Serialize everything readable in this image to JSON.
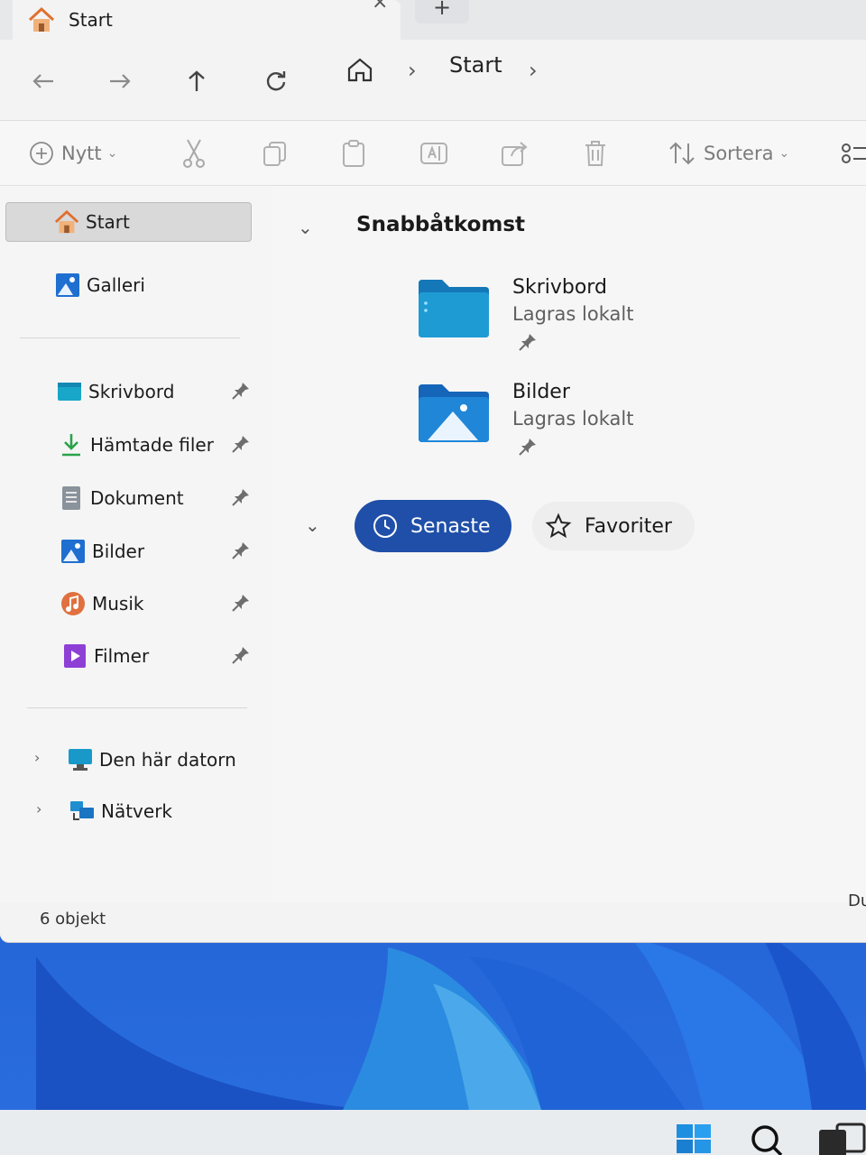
{
  "window": {
    "tab_title": "Start",
    "tab_close": "×",
    "new_tab": "+"
  },
  "navigation": {
    "breadcrumb": [
      "Start"
    ],
    "chevron": "›"
  },
  "toolbar": {
    "new_label": "Nytt",
    "sort_label": "Sortera",
    "dropdown_glyph": "⌄"
  },
  "sidebar": {
    "top_items": [
      {
        "label": "Start",
        "icon": "home-icon",
        "selected": true
      },
      {
        "label": "Galleri",
        "icon": "gallery-icon"
      }
    ],
    "pinned_items": [
      {
        "label": "Skrivbord",
        "icon": "desktop-icon"
      },
      {
        "label": "Hämtade filer",
        "icon": "downloads-icon"
      },
      {
        "label": "Dokument",
        "icon": "documents-icon"
      },
      {
        "label": "Bilder",
        "icon": "pictures-icon"
      },
      {
        "label": "Musik",
        "icon": "music-icon"
      },
      {
        "label": "Filmer",
        "icon": "videos-icon"
      }
    ],
    "locations": [
      {
        "label": "Den här datorn",
        "icon": "this-pc-icon"
      },
      {
        "label": "Nätverk",
        "icon": "network-icon"
      }
    ],
    "expander_glyph": "›"
  },
  "content": {
    "section_title": "Snabbåtkomst",
    "chevron": "⌄",
    "quick_access": [
      {
        "name": "Skrivbord",
        "sub": "Lagras lokalt",
        "icon": "desktop-folder-icon"
      },
      {
        "name": "Bilder",
        "sub": "Lagras lokalt",
        "icon": "pictures-folder-icon"
      }
    ],
    "recent_label": "Senaste",
    "favorites_label": "Favoriter"
  },
  "status": {
    "item_count": "6 objekt",
    "right_text": "Du"
  },
  "colors": {
    "accent": "#1f4fa8",
    "folder_blue": "#1e8fd6",
    "wallpaper_blue": "#2a6ee0"
  }
}
